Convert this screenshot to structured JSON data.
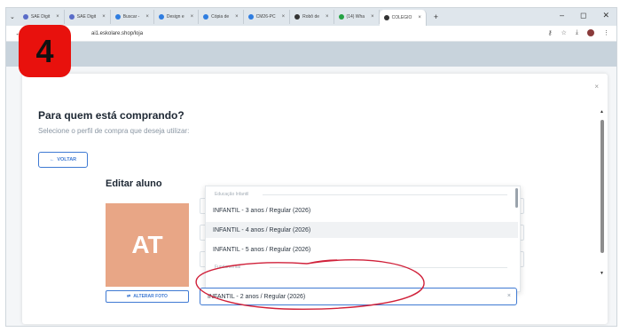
{
  "browser": {
    "tabs": [
      {
        "label": "SAE Digit",
        "color": "#5a6cc8"
      },
      {
        "label": "SAE Digit",
        "color": "#5a6cc8"
      },
      {
        "label": "Buscar - ",
        "color": "#2f7de0"
      },
      {
        "label": "Design e",
        "color": "#2f7de0"
      },
      {
        "label": "Cópia de",
        "color": "#2f7de0"
      },
      {
        "label": "CM26-PC",
        "color": "#2f7de0"
      },
      {
        "label": "Robô de",
        "color": "#333333"
      },
      {
        "label": "(14) Wha",
        "color": "#25a244"
      },
      {
        "label": "COLEGIO",
        "color": "#333333",
        "active": true
      }
    ],
    "url": "ai1.eskolare.shop/loja",
    "controls": {
      "minimize": "–",
      "maximize": "◻",
      "close": "✕"
    }
  },
  "step_badge": "4",
  "modal": {
    "title": "Para quem está comprando?",
    "subtitle": "Selecione o perfil de compra que deseja utilizar:",
    "back_label": "VOLTAR",
    "close_label": "×",
    "section_title": "Editar aluno",
    "avatar_initials": "AT",
    "change_photo_label": "ALTERAR FOTO",
    "dropdown": {
      "group1_label": "Educação Infantil",
      "group2_label": "Fundamental",
      "options": [
        "INFANTIL - 3 anos / Regular (2026)",
        "INFANTIL - 4 anos / Regular (2026)",
        "INFANTIL - 5 anos / Regular (2026)"
      ]
    },
    "selected_value": "INFANTIL - 2 anos / Regular (2026)",
    "clear_label": "×"
  },
  "colors": {
    "accent": "#3f7ad3",
    "avatar_bg": "#e8a686",
    "badge": "#e8110d",
    "annotation": "#d0213a"
  }
}
